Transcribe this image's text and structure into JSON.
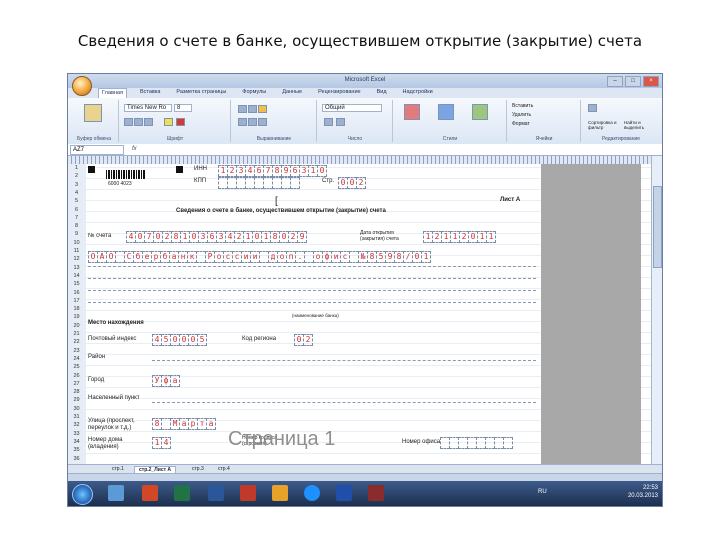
{
  "slide": {
    "title": "Сведения о счете в банке, осуществившем открытие (закрытие) счета"
  },
  "window": {
    "title": "Microsoft Excel",
    "min": "–",
    "max": "□",
    "close": "×"
  },
  "ribbon": {
    "tabs": [
      "Главная",
      "Вставка",
      "Разметка страницы",
      "Формулы",
      "Данные",
      "Рецензирование",
      "Вид",
      "Надстройки"
    ],
    "groups": [
      "Буфер обмена",
      "Шрифт",
      "Выравнивание",
      "Число",
      "Стили",
      "Ячейки",
      "Редактирование"
    ],
    "font_name": "Times New Ro",
    "font_size": "8",
    "number_format": "Общий",
    "buttons": {
      "insert": "Вставить",
      "delete": "Удалить",
      "format": "Формат",
      "sort": "Сортировка и фильтр",
      "find": "Найти и выделить"
    }
  },
  "formula_bar": {
    "name_box": "AZ7",
    "fx": "fx"
  },
  "rows": [
    "1",
    "2",
    "3",
    "4",
    "5",
    "6",
    "7",
    "8",
    "9",
    "10",
    "11",
    "12",
    "13",
    "14",
    "15",
    "16",
    "17",
    "18",
    "19",
    "20",
    "21",
    "22",
    "23",
    "24",
    "25",
    "26",
    "27",
    "28",
    "29",
    "30",
    "31",
    "32",
    "33",
    "34",
    "35",
    "36"
  ],
  "form": {
    "inn_label": "ИНН",
    "inn_digits": [
      "1",
      "2",
      "3",
      "4",
      "6",
      "7",
      "8",
      "9",
      "6",
      "3",
      "1",
      "0"
    ],
    "kpp_label": "КПП",
    "page_label": "Стр.",
    "page_digits": [
      "0",
      "0",
      "2"
    ],
    "barcode_text": "6000 4023",
    "sheet_label": "Лист А",
    "heading": "Сведения о счете в банке, осуществившем открытие (закрытие) счета",
    "account_label": "№ счета",
    "account_digits": [
      "4",
      "0",
      "7",
      "0",
      "2",
      "8",
      "1",
      "0",
      "3",
      "6",
      "3",
      "4",
      "2",
      "1",
      "0",
      "1",
      "8",
      "0",
      "2",
      "9"
    ],
    "date_label": "Дата открытия (закрытия) счета",
    "date_digits": [
      "1",
      "2",
      "1",
      "1",
      "2",
      "0",
      "1",
      "1"
    ],
    "bank_chars": [
      "О",
      "А",
      "О",
      "",
      "С",
      "б",
      "е",
      "р",
      "б",
      "а",
      "н",
      "к",
      "",
      "Р",
      "о",
      "с",
      "с",
      "и",
      "и",
      "",
      "д",
      "о",
      "п",
      ".",
      "",
      "о",
      "ф",
      "и",
      "с",
      "",
      "№",
      "8",
      "5",
      "9",
      "8",
      "/",
      "0",
      "1"
    ],
    "bank_note": "(наименование банка)",
    "location_label": "Место нахождения",
    "postal_label": "Почтовый индекс",
    "postal_digits": [
      "4",
      "5",
      "0",
      "0",
      "0",
      "5"
    ],
    "region_code_label": "Код региона",
    "region_digits": [
      "0",
      "2"
    ],
    "district_label": "Район",
    "city_label": "Город",
    "city_chars": [
      "У",
      "ф",
      "а"
    ],
    "settlement_label": "Населенный пункт",
    "street_label": "Улица (проспект, переулок и т.д.)",
    "street_chars": [
      "8",
      "",
      "М",
      "а",
      "р",
      "т",
      "а"
    ],
    "house_label": "Номер дома (владения)",
    "house_digits": [
      "1",
      "4"
    ],
    "building_label": "Номер корпуса (строения)",
    "office_label": "Номер офиса",
    "watermark": "Страница 1"
  },
  "sheet_tabs": [
    "стр.1",
    "стр.2_Лист А",
    "стр.3",
    "стр.4"
  ],
  "taskbar": {
    "lang": "RU",
    "time": "22:53",
    "date": "20.03.2013"
  }
}
